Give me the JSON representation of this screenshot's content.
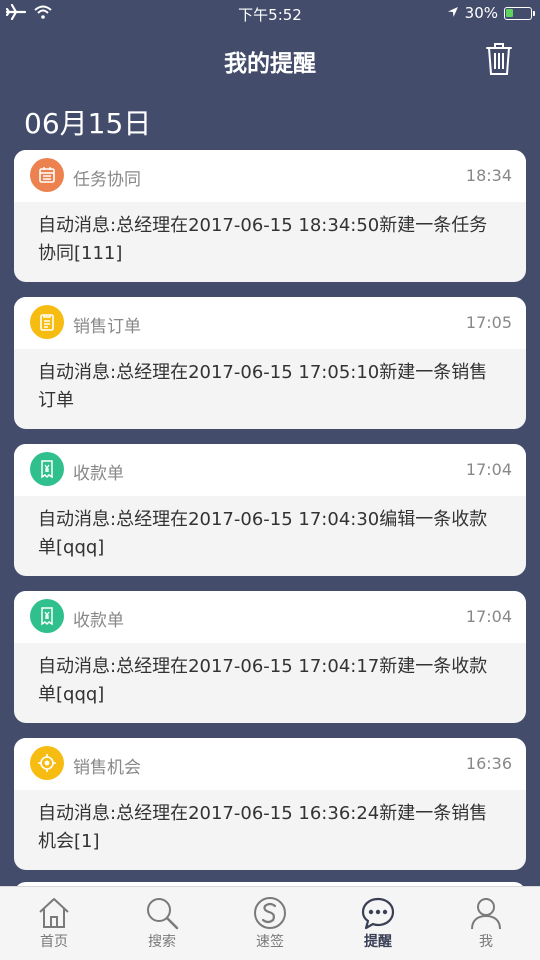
{
  "status_bar": {
    "time": "下午5:52",
    "battery": "30%",
    "battery_level": 0.3
  },
  "header": {
    "title": "我的提醒"
  },
  "date_header": "06月15日",
  "reminders": [
    {
      "type": "任务协同",
      "time": "18:34",
      "message": "自动消息:总经理在2017-06-15 18:34:50新建一条任务协同[111]",
      "icon": "calendar-icon",
      "color": "#ec8250"
    },
    {
      "type": "销售订单",
      "time": "17:05",
      "message": "自动消息:总经理在2017-06-15 17:05:10新建一条销售订单",
      "icon": "clipboard-icon",
      "color": "#f7bc12"
    },
    {
      "type": "收款单",
      "time": "17:04",
      "message": "自动消息:总经理在2017-06-15 17:04:30编辑一条收款单[qqq]",
      "icon": "receipt-icon",
      "color": "#2fc08e"
    },
    {
      "type": "收款单",
      "time": "17:04",
      "message": "自动消息:总经理在2017-06-15 17:04:17新建一条收款单[qqq]",
      "icon": "receipt-icon",
      "color": "#2fc08e"
    },
    {
      "type": "销售机会",
      "time": "16:36",
      "message": "自动消息:总经理在2017-06-15 16:36:24新建一条销售机会[1]",
      "icon": "target-icon",
      "color": "#f7bc12"
    }
  ],
  "tabs": [
    {
      "label": "首页",
      "icon": "home-icon"
    },
    {
      "label": "搜索",
      "icon": "search-icon"
    },
    {
      "label": "速签",
      "icon": "sign-icon"
    },
    {
      "label": "提醒",
      "icon": "chat-icon",
      "active": true
    },
    {
      "label": "我",
      "icon": "user-icon"
    }
  ]
}
